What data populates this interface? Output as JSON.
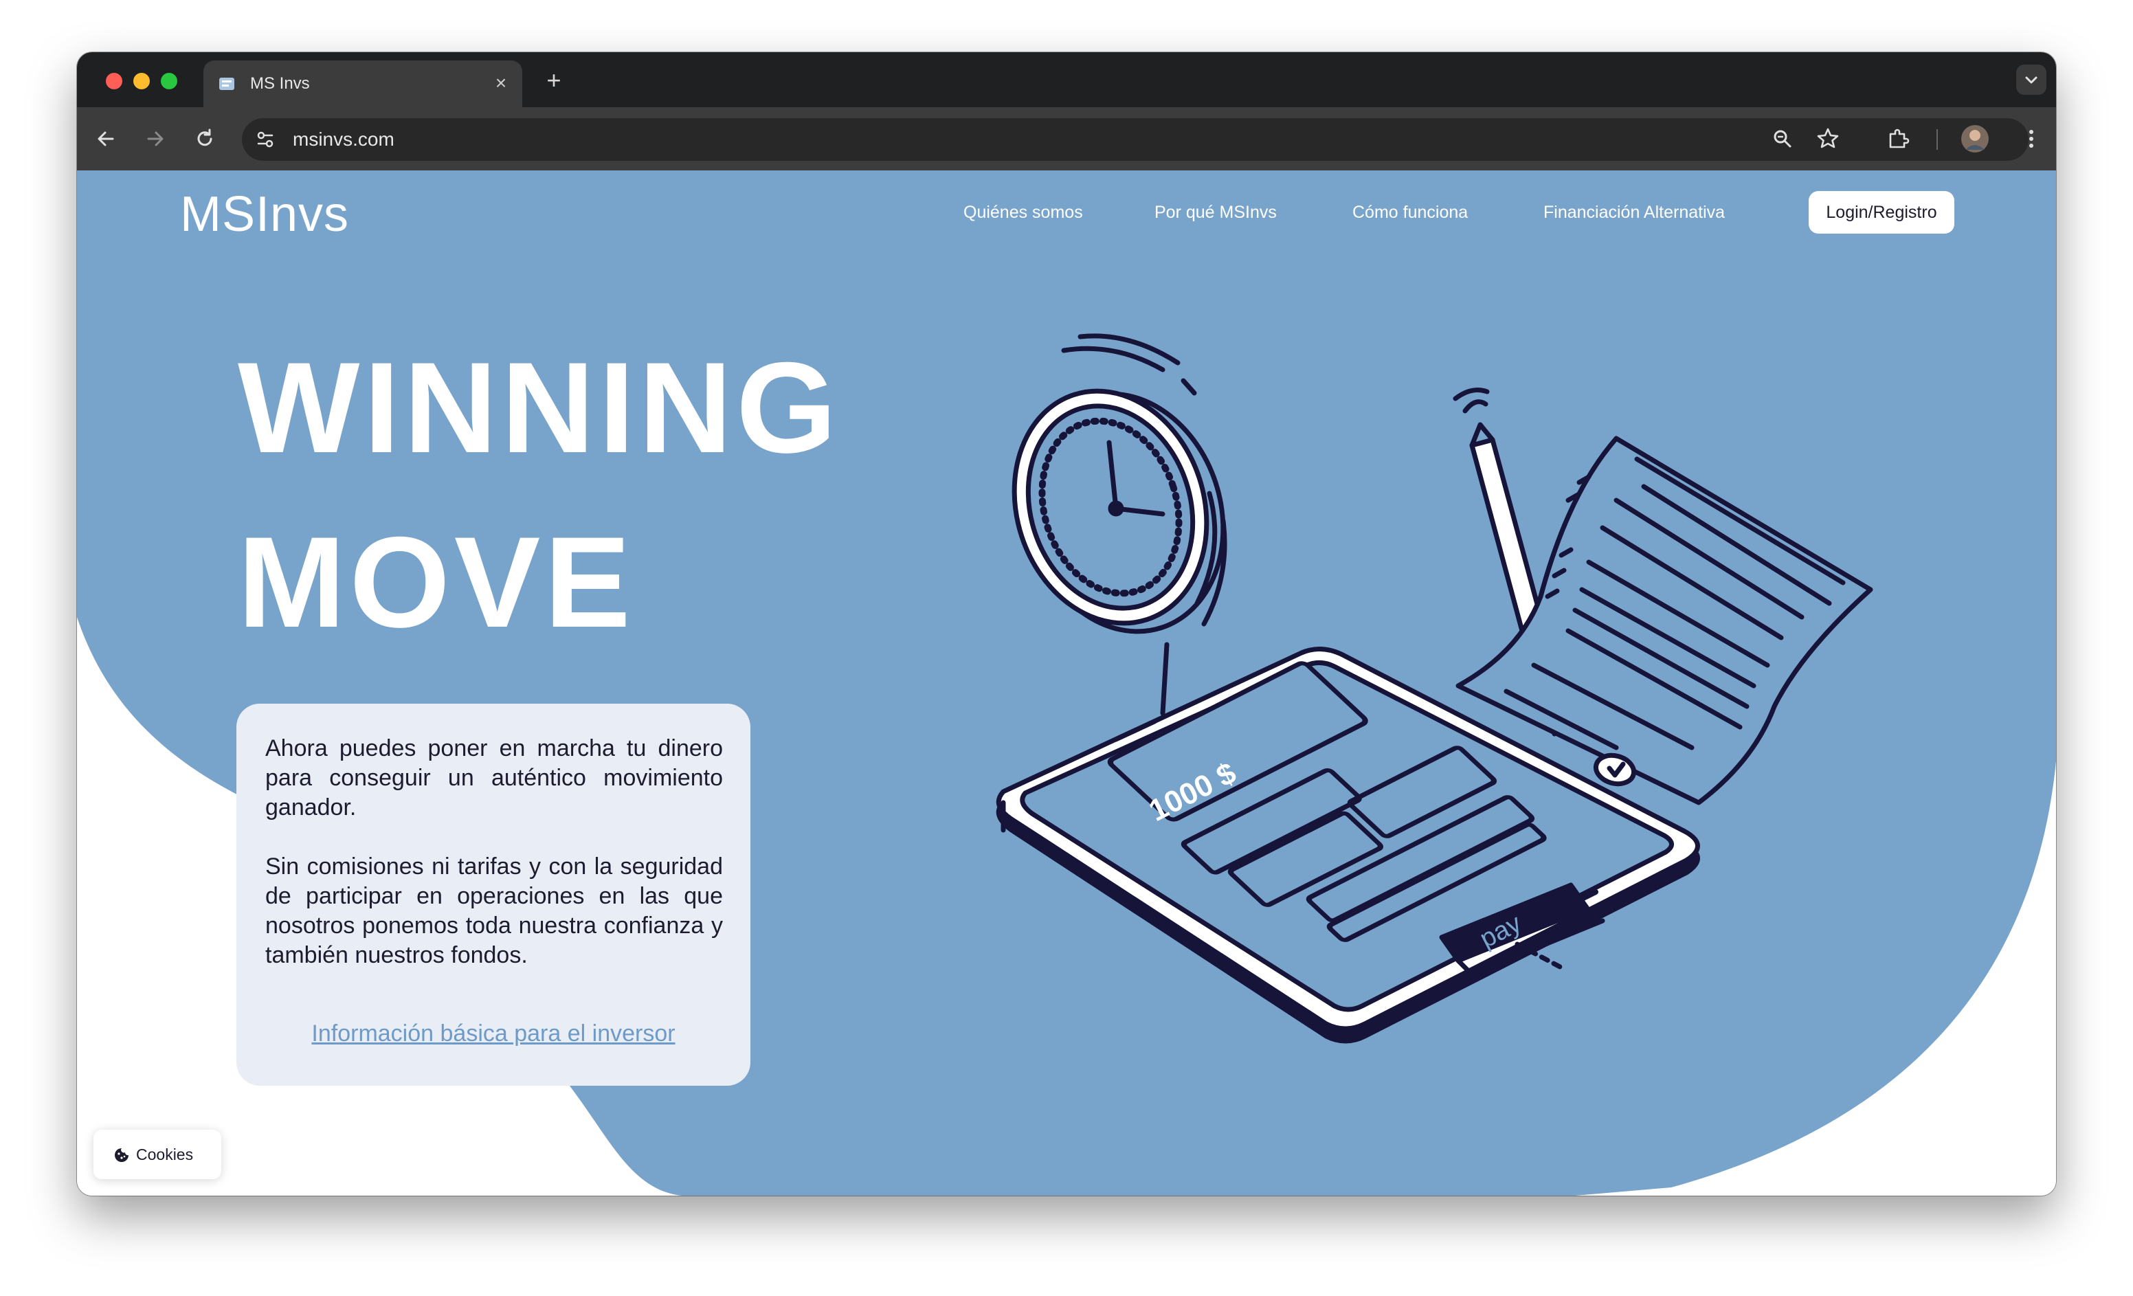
{
  "browser": {
    "tab_title": "MS Invs",
    "tab_close": "×",
    "new_tab": "+",
    "url": "msinvs.com",
    "icons": [
      "back-icon",
      "forward-icon",
      "reload-icon",
      "site-info-icon",
      "zoom-icon",
      "bookmark-star-icon",
      "extensions-icon",
      "profile-avatar",
      "menu-kebab-icon",
      "tab-list-chevron-icon"
    ]
  },
  "site": {
    "logo": "MSInvs",
    "nav": [
      "Quiénes somos",
      "Por qué MSInvs",
      "Cómo funciona",
      "Financiación Alternativa"
    ],
    "login": "Login/Registro"
  },
  "hero": {
    "title_line1": "WINNING",
    "title_line2": "MOVE",
    "paragraph1": "Ahora puedes poner en marcha tu dinero para conseguir un auténtico movimiento ganador.",
    "paragraph2": "Sin comisiones ni tarifas y con la seguridad de participar en operaciones en las que nosotros ponemos toda nuestra confianza y también nuestros fondos.",
    "link": "Información básica para el inversor"
  },
  "illustration": {
    "amount": "1000 $",
    "pay_label": "pay"
  },
  "cookies": {
    "label": "Cookies"
  },
  "colors": {
    "hero_blue": "#78a4cb",
    "ink": "#17143a",
    "link": "#6d9ac6",
    "panel": "#e9eef6"
  }
}
